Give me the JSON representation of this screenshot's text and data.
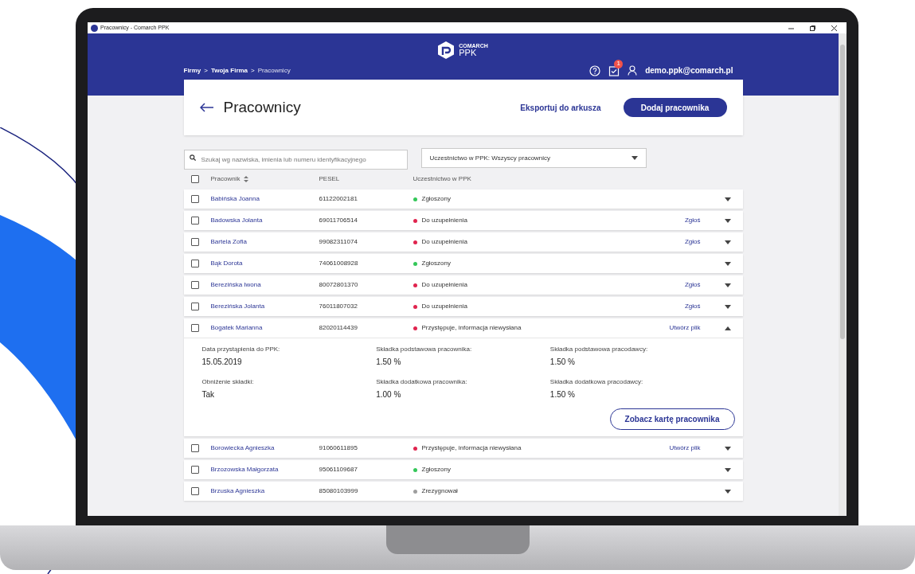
{
  "window": {
    "title": "Pracownicy - Comarch PPK"
  },
  "header": {
    "logo_top": "COMARCH",
    "logo_bottom": "PPK",
    "breadcrumb": [
      "Firmy",
      "Twoja Firma",
      "Pracownicy"
    ],
    "breadcrumb_separator": ">",
    "notifications": "1",
    "user": "demo.ppk@comarch.pl"
  },
  "page": {
    "title": "Pracownicy",
    "export_link": "Eksportuj do arkusza",
    "add_button": "Dodaj pracownika"
  },
  "search": {
    "placeholder": "Szukaj wg nazwiska, imienia lub numeru identyfikacyjnego"
  },
  "filter": {
    "value": "Uczestnictwo w PPK: Wszyscy pracownicy"
  },
  "table": {
    "columns": [
      "Pracownik",
      "PESEL",
      "Uczestnictwo w PPK"
    ],
    "all_checked": false,
    "rows": [
      {
        "name": "Babińska Joanna",
        "pesel": "61122002181",
        "status": "Zgłoszony",
        "color": "#34c759",
        "action": "",
        "checked": false,
        "expanded": false
      },
      {
        "name": "Badowska Jolanta",
        "pesel": "69011706514",
        "status": "Do uzupełnienia",
        "color": "#e0244e",
        "action": "Zgłoś",
        "checked": false,
        "expanded": false
      },
      {
        "name": "Bartela Zofia",
        "pesel": "99082311074",
        "status": "Do uzupełnienia",
        "color": "#e0244e",
        "action": "Zgłoś",
        "checked": false,
        "expanded": false
      },
      {
        "name": "Bąk Dorota",
        "pesel": "74061008928",
        "status": "Zgłoszony",
        "color": "#34c759",
        "action": "",
        "checked": false,
        "expanded": false
      },
      {
        "name": "Berezińska Iwona",
        "pesel": "80072801370",
        "status": "Do uzupełnienia",
        "color": "#e0244e",
        "action": "Zgłoś",
        "checked": false,
        "expanded": false
      },
      {
        "name": "Berezińska Jolanta",
        "pesel": "76011807032",
        "status": "Do uzupełnienia",
        "color": "#e0244e",
        "action": "Zgłoś",
        "checked": false,
        "expanded": false
      },
      {
        "name": "Bogatek Marianna",
        "pesel": "82020114439",
        "status": "Przystępuje, informacja niewysłana",
        "color": "#e0244e",
        "action": "Utwórz plik",
        "checked": false,
        "expanded": true,
        "details": [
          {
            "label": "Data przystąpienia do PPK:",
            "value": "15.05.2019"
          },
          {
            "label": "Składka podstawowa pracownika:",
            "value": "1.50 %"
          },
          {
            "label": "Składka podstawowa pracodawcy:",
            "value": "1.50 %"
          },
          {
            "label": "Obniżenie składki:",
            "value": "Tak"
          },
          {
            "label": "Składka dodatkowa pracownika:",
            "value": "1.00 %"
          },
          {
            "label": "Składka dodatkowa pracodawcy:",
            "value": "1.50 %"
          }
        ],
        "details_button": "Zobacz kartę pracownika"
      },
      {
        "name": "Borowiecka Agnieszka",
        "pesel": "91060611895",
        "status": "Przystępuje, informacja niewysłana",
        "color": "#e0244e",
        "action": "Utwórz plik",
        "checked": false,
        "expanded": false
      },
      {
        "name": "Brzozowska Małgorzata",
        "pesel": "95061109687",
        "status": "Zgłoszony",
        "color": "#34c759",
        "action": "",
        "checked": false,
        "expanded": false
      },
      {
        "name": "Brzuska Agnieszka",
        "pesel": "85080103999",
        "status": "Zrezygnował",
        "color": "#9e9e9e",
        "action": "",
        "checked": false,
        "expanded": false
      }
    ]
  }
}
